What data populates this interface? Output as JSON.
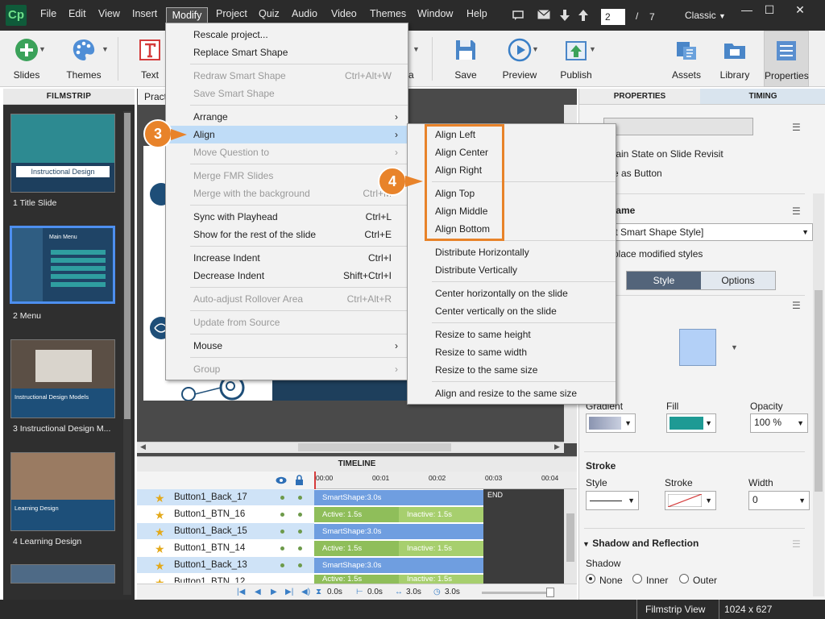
{
  "app": {
    "logo": "Cp",
    "menus": [
      "File",
      "Edit",
      "View",
      "Insert",
      "Modify",
      "Project",
      "Quiz",
      "Audio",
      "Video",
      "Themes",
      "Window",
      "Help"
    ],
    "page_current": "2",
    "page_separator": "/",
    "page_total": "7",
    "workspace": "Classic"
  },
  "toolbar": {
    "slides": "Slides",
    "themes": "Themes",
    "text": "Text",
    "save": "Save",
    "preview": "Preview",
    "publish": "Publish",
    "assets": "Assets",
    "library": "Library",
    "properties": "Properties",
    "partial_label": "a"
  },
  "filmstrip": {
    "header": "FILMSTRIP",
    "slides": [
      {
        "label": "1 Title Slide",
        "title": "Instructional Design"
      },
      {
        "label": "2 Menu",
        "title": "Main Menu"
      },
      {
        "label": "3 Instructional Design M...",
        "title": "Instructional Design Models"
      },
      {
        "label": "4 Learning Design",
        "title": "Learning Design"
      }
    ]
  },
  "canvas": {
    "tab": "Pract"
  },
  "modify_menu": {
    "items": [
      {
        "label": "Rescale project...",
        "shortcut": "",
        "disabled": false,
        "submenu": false
      },
      {
        "label": "Replace Smart Shape",
        "shortcut": "",
        "disabled": false,
        "submenu": false
      },
      {
        "label": "Redraw Smart Shape",
        "shortcut": "Ctrl+Alt+W",
        "disabled": true,
        "submenu": false
      },
      {
        "label": "Save Smart Shape",
        "shortcut": "",
        "disabled": true,
        "submenu": false
      },
      {
        "label": "Arrange",
        "shortcut": "",
        "disabled": false,
        "submenu": true
      },
      {
        "label": "Align",
        "shortcut": "",
        "disabled": false,
        "submenu": true
      },
      {
        "label": "Move Question to",
        "shortcut": "",
        "disabled": true,
        "submenu": true
      },
      {
        "label": "Merge FMR Slides",
        "shortcut": "",
        "disabled": true,
        "submenu": false
      },
      {
        "label": "Merge with the background",
        "shortcut": "Ctrl+M",
        "disabled": true,
        "submenu": false
      },
      {
        "label": "Sync with Playhead",
        "shortcut": "Ctrl+L",
        "disabled": false,
        "submenu": false
      },
      {
        "label": "Show for the rest of the slide",
        "shortcut": "Ctrl+E",
        "disabled": false,
        "submenu": false
      },
      {
        "label": "Increase Indent",
        "shortcut": "Ctrl+I",
        "disabled": false,
        "submenu": false
      },
      {
        "label": "Decrease Indent",
        "shortcut": "Shift+Ctrl+I",
        "disabled": false,
        "submenu": false
      },
      {
        "label": "Auto-adjust Rollover Area",
        "shortcut": "Ctrl+Alt+R",
        "disabled": true,
        "submenu": false
      },
      {
        "label": "Update from Source",
        "shortcut": "",
        "disabled": true,
        "submenu": false
      },
      {
        "label": "Mouse",
        "shortcut": "",
        "disabled": false,
        "submenu": true
      },
      {
        "label": "Group",
        "shortcut": "",
        "disabled": true,
        "submenu": true
      }
    ]
  },
  "align_menu": {
    "items": [
      "Align Left",
      "Align Center",
      "Align Right",
      "Align Top",
      "Align Middle",
      "Align Bottom",
      "Distribute Horizontally",
      "Distribute Vertically",
      "Center horizontally on the slide",
      "Center vertically on the slide",
      "Resize to same height",
      "Resize to same width",
      "Resize to the same size",
      "Align and resize to the same size"
    ]
  },
  "callouts": {
    "step3": "3",
    "step4": "4"
  },
  "timeline": {
    "header": "TIMELINE",
    "ruler": [
      "00:00",
      "00:01",
      "00:02",
      "00:03",
      "00:04"
    ],
    "end_label": "END",
    "rows": [
      {
        "name": "Button1_Back_17",
        "bar": "SmartShape:3.0s"
      },
      {
        "name": "Button1_BTN_16",
        "active": "Active: 1.5s",
        "inactive": "Inactive: 1.5s"
      },
      {
        "name": "Button1_Back_15",
        "bar": "SmartShape:3.0s"
      },
      {
        "name": "Button1_BTN_14",
        "active": "Active: 1.5s",
        "inactive": "Inactive: 1.5s"
      },
      {
        "name": "Button1_Back_13",
        "bar": "SmartShape:3.0s"
      },
      {
        "name": "Button1_BTN_12",
        "active": "Active: 1.5s",
        "inactive": "Inactive: 1.5s"
      }
    ],
    "footer": {
      "t1": "0.0s",
      "t2": "0.0s",
      "t3": "3.0s",
      "t4": "3.0s"
    }
  },
  "properties": {
    "tab_properties": "PROPERTIES",
    "tab_timing": "TIMING",
    "retain_state": "tain State on Slide Revisit",
    "use_as_button": "e as Button",
    "style_name_heading": "lame",
    "style_value": "ult Smart Shape Style]",
    "replace_styles": "place modified styles",
    "tab_style": "Style",
    "tab_options": "Options",
    "gradient": "Gradient",
    "fill": "Fill",
    "opacity": "Opacity",
    "opacity_value": "100 %",
    "stroke_heading": "Stroke",
    "stroke_style": "Style",
    "stroke_label": "Stroke",
    "width": "Width",
    "width_value": "0",
    "shadow_heading": "Shadow and Reflection",
    "shadow": "Shadow",
    "none": "None",
    "inner": "Inner",
    "outer": "Outer",
    "fill_color": "#1e9a94"
  },
  "status": {
    "view": "Filmstrip View",
    "size": "1024 x 627"
  }
}
